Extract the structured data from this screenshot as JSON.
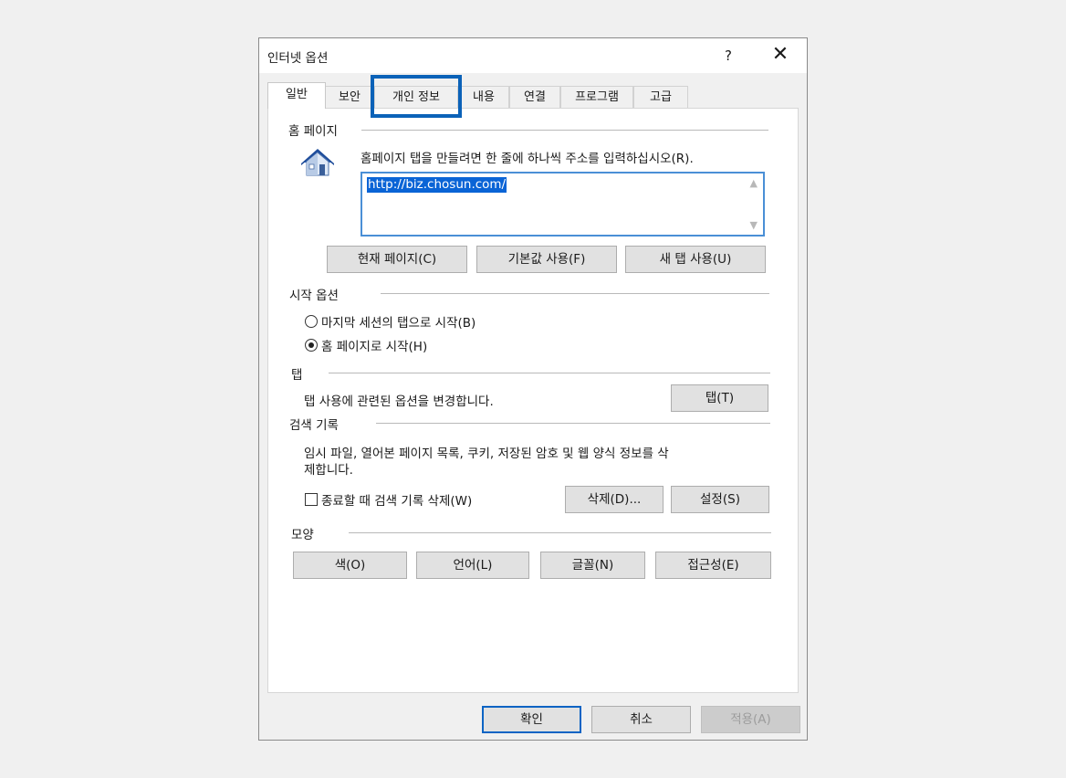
{
  "window": {
    "title": "인터넷 옵션",
    "help_label": "?",
    "close_label": "✕"
  },
  "tabs": [
    "일반",
    "보안",
    "개인 정보",
    "내용",
    "연결",
    "프로그램",
    "고급"
  ],
  "home": {
    "section_label": "홈 페이지",
    "instruction": "홈페이지 탭을 만들려면 한 줄에 하나씩 주소를 입력하십시오(R).",
    "url": "http://biz.chosun.com/",
    "buttons": {
      "current": "현재 페이지(C)",
      "default": "기본값 사용(F)",
      "new_tab": "새 탭 사용(U)"
    }
  },
  "startup": {
    "section_label": "시작 옵션",
    "option_last": "마지막 세션의 탭으로 시작(B)",
    "option_home": "홈 페이지로 시작(H)"
  },
  "tabs_section": {
    "section_label": "탭",
    "description": "탭 사용에 관련된 옵션을 변경합니다.",
    "button": "탭(T)"
  },
  "history": {
    "section_label": "검색 기록",
    "description_line1": "임시 파일, 열어본 페이지 목록, 쿠키, 저장된 암호 및 웹 양식 정보를 삭",
    "description_line2": "제합니다.",
    "checkbox_label": "종료할 때 검색 기록 삭제(W)",
    "delete_button": "삭제(D)...",
    "settings_button": "설정(S)"
  },
  "appearance": {
    "section_label": "모양",
    "buttons": {
      "colors": "색(O)",
      "languages": "언어(L)",
      "fonts": "글꼴(N)",
      "accessibility": "접근성(E)"
    }
  },
  "footer": {
    "ok": "확인",
    "cancel": "취소",
    "apply": "적용(A)"
  },
  "colors": {
    "highlight": "#0b62b8",
    "selection": "#0a64d6"
  }
}
